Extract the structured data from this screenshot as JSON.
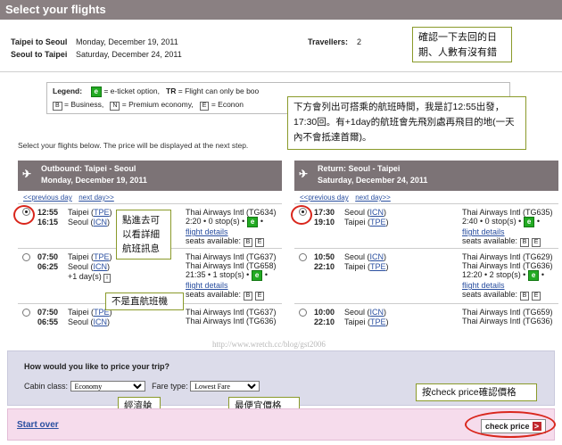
{
  "header": {
    "title": "Select your flights"
  },
  "trip": {
    "outbound_route": "Taipei to Seoul",
    "outbound_date": "Monday, December 19, 2011",
    "return_route": "Seoul to Taipei",
    "return_date": "Saturday, December 24, 2011",
    "travellers_label": "Travellers:",
    "travellers_value": "2"
  },
  "notes": {
    "confirm": "確認一下去回的日期、人數有沒有錯",
    "times": "下方會列出可搭乘的航班時間，我是訂12:55出發，17:30回。有+1day的航班會先飛別處再飛目的地(一天內不會抵達首爾)。",
    "details": "點進去可以看詳細航班訊息",
    "nonstop": "不是直航班機",
    "economy": "經濟艙",
    "lowest": "最便宜價格",
    "check": "按check price確認價格"
  },
  "legend": {
    "title": "Legend:",
    "e_badge": "e",
    "e_text": "= e-ticket option,",
    "tr": "TR",
    "tr_text": "= Flight can only be boo",
    "b_badge": "B",
    "b_text": "= Business,",
    "n_badge": "N",
    "n_text": "= Premium economy,",
    "e2_badge": "E",
    "e2_text": "= Econon"
  },
  "instructions": "Select your flights below. The price will be displayed at the next step.",
  "outbound": {
    "title": "Outbound: Taipei - Seoul",
    "date": "Monday, December 19, 2011",
    "prev": "previous day",
    "next": "next day>>",
    "rows": [
      {
        "dep_time": "12:55",
        "arr_time": "16:15",
        "dep_city": "Taipei (",
        "dep_code": "TPE",
        "arr_city": "Seoul (",
        "arr_code": "ICN",
        "airline1": "Thai Airways Intl (TG634)",
        "duration": "2:20 • 0 stop(s) •",
        "details": "flight details",
        "seats": "seats available:",
        "class1": "B",
        "class2": "E"
      },
      {
        "dep_time": "07:50",
        "arr_time": "06:25",
        "dep_city": "Taipei (",
        "dep_code": "TPE",
        "arr_city": "Seoul (",
        "arr_code": "ICN",
        "plus_day": "+1 day(s)",
        "airline1": "Thai Airways Intl (TG637)",
        "airline2": "Thai Airways Intl (TG658)",
        "duration": "21:35 • 1 stop(s) •",
        "details": "flight details",
        "seats": "seats available:",
        "class1": "B",
        "class2": "E"
      },
      {
        "dep_time": "07:50",
        "arr_time": "06:55",
        "dep_city": "Taipei (",
        "dep_code": "TPE",
        "arr_city": "Seoul (",
        "arr_code": "ICN",
        "airline1": "Thai Airways Intl (TG637)",
        "airline2": "Thai Airways Intl (TG636)"
      }
    ]
  },
  "return": {
    "title": "Return: Seoul - Taipei",
    "date": "Saturday, December 24, 2011",
    "prev": "previous day",
    "next": "next day>>",
    "rows": [
      {
        "dep_time": "17:30",
        "arr_time": "19:10",
        "dep_city": "Seoul (",
        "dep_code": "ICN",
        "arr_city": "Taipei (",
        "arr_code": "TPE",
        "airline1": "Thai Airways Intl (TG635)",
        "duration": "2:40 • 0 stop(s) •",
        "details": "flight details",
        "seats": "seats available:",
        "class1": "B",
        "class2": "E"
      },
      {
        "dep_time": "10:50",
        "arr_time": "22:10",
        "dep_city": "Seoul (",
        "dep_code": "ICN",
        "arr_city": "Taipei (",
        "arr_code": "TPE",
        "airline1": "Thai Airways Intl (TG629)",
        "airline2": "Thai Airways Intl (TG636)",
        "duration": "12:20 • 2 stop(s) •",
        "details": "flight details",
        "seats": "seats available:",
        "class1": "B",
        "class2": "E"
      },
      {
        "dep_time": "10:00",
        "arr_time": "22:10",
        "dep_city": "Seoul (",
        "dep_code": "ICN",
        "arr_city": "Taipei (",
        "arr_code": "TPE",
        "airline1": "Thai Airways Intl (TG659)",
        "airline2": "Thai Airways Intl (TG636)"
      }
    ]
  },
  "watermark": "http://www.wretch.cc/blog/gst2006",
  "pricing": {
    "question": "How would you like to price your trip?",
    "cabin_label": "Cabin class:",
    "cabin_value": "Economy",
    "fare_label": "Fare type:",
    "fare_value": "Lowest Fare"
  },
  "footer": {
    "start_over": "Start over",
    "check_price": "check price",
    "arrow": ">"
  },
  "colors": {
    "header": "#8a8082",
    "accent_red": "#d9261c",
    "eticket_green": "#22aa22"
  }
}
